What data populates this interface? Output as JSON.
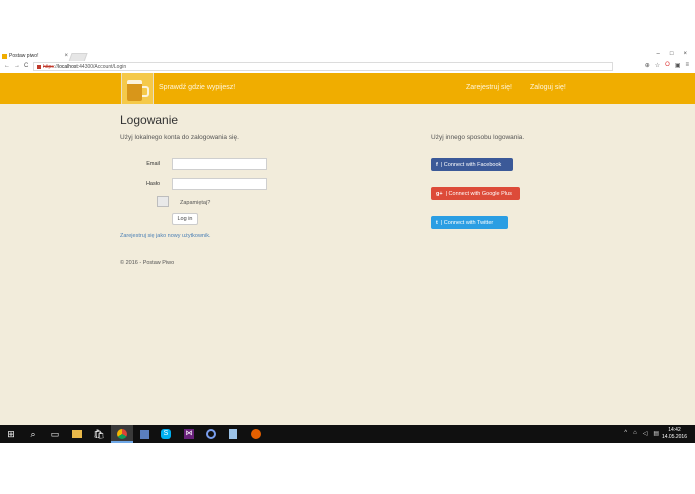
{
  "browser": {
    "tab_title": "Postaw piwo!",
    "tab_close": "×",
    "url_scheme": "https",
    "url_sep": "://",
    "url_host": "localhost",
    "url_rest": ":44300/Account/Login",
    "back": "←",
    "forward": "→",
    "reload": "C",
    "window_buttons": [
      "–",
      "□",
      "×"
    ],
    "toolbar_icons": [
      "zoom-icon",
      "star-icon",
      "opera-icon",
      "extension-icon",
      "menu-icon"
    ]
  },
  "site": {
    "brand": "Sprawdź gdzie wypijesz!",
    "nav_register": "Zarejestruj się!",
    "nav_login": "Zaloguj się!"
  },
  "login": {
    "title": "Logowanie",
    "lead": "Użyj lokalnego konta do zalogowania się.",
    "email_label": "Email",
    "email_value": "",
    "password_label": "Hasło",
    "password_value": "",
    "remember_label": "Zapamiętaj?",
    "submit_label": "Log in",
    "register_link": "Zarejestruj się jako nowy użytkownik.",
    "copyright": "© 2016 - Postaw Piwo"
  },
  "external": {
    "lead": "Użyj innego sposobu logowania.",
    "facebook_icon": "f",
    "facebook": "| Connect with Facebook",
    "google_icon": "g+",
    "google": "| Connect with Google Plus",
    "twitter_icon": "t",
    "twitter": "| Connect with Twitter",
    "colors": {
      "facebook": "#3b5998",
      "google": "#dd4b39",
      "twitter": "#2b9ee3"
    }
  },
  "colors": {
    "header": "#f0ad00",
    "background": "#f2ecdb",
    "link": "#4a7fb5"
  },
  "taskbar": {
    "time": "14:42",
    "date": "14.05.2016",
    "apps": [
      "windows-start-icon",
      "search-icon",
      "task-view-icon",
      "file-explorer-icon",
      "store-icon",
      "chrome-icon",
      "app-icon",
      "skype-icon",
      "visual-studio-icon",
      "network-app-icon",
      "notepad-icon",
      "firefox-icon"
    ]
  }
}
